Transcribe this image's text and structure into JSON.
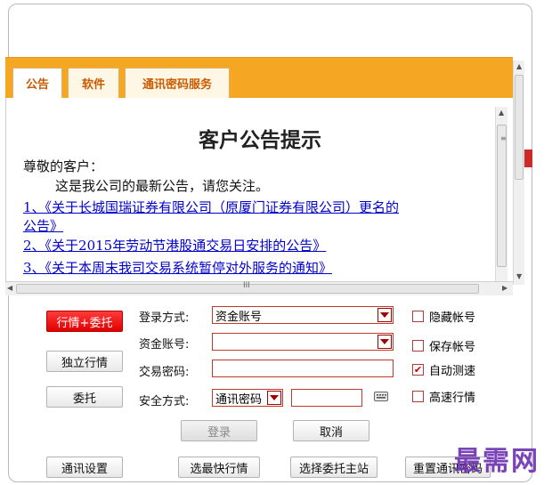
{
  "tabs": [
    {
      "label": "公告"
    },
    {
      "label": "软件"
    },
    {
      "label": "通讯密码服务"
    }
  ],
  "notice": {
    "title": "客户公告提示",
    "greeting": "尊敬的客户：",
    "intro": "这是我公司的最新公告，请您关注。",
    "links": [
      {
        "text": "1、《关于长城国瑞证券有限公司（原厦门证券有限公司）更名的"
      },
      {
        "text": "公告》"
      },
      {
        "text": "2、《关于2015年劳动节港股通交易日安排的公告》"
      },
      {
        "text": "3、《关于本周末我司交易系统暂停对外服务的通知》"
      }
    ]
  },
  "scroll": {
    "grip": "III"
  },
  "left_buttons": {
    "quote_trade": "行情+委托",
    "standalone_quote": "独立行情",
    "trade": "委托"
  },
  "form": {
    "login_method_label": "登录方式:",
    "login_method_value": "资金账号",
    "account_label": "资金账号:",
    "account_value": "",
    "password_label": "交易密码:",
    "password_value": "",
    "security_label": "安全方式:",
    "security_value": "通讯密码",
    "security_code": "",
    "login_button": "登录",
    "cancel_button": "取消"
  },
  "options": {
    "hide_account": {
      "label": "隐藏帐号",
      "checked": false
    },
    "save_account": {
      "label": "保存帐号",
      "checked": false
    },
    "auto_speed": {
      "label": "自动测速",
      "checked": true
    },
    "fast_quote": {
      "label": "高速行情",
      "checked": false
    }
  },
  "bottom_buttons": {
    "comm_settings": "通讯设置",
    "fastest_quote": "选最快行情",
    "select_host": "选择委托主站",
    "reset_comm": "重置通讯密码"
  },
  "watermark": "最需网",
  "colors": {
    "tab_bar": "#f5a623",
    "accent_red": "#e10000",
    "link": "#0000cc",
    "watermark": "#6c2fb0"
  },
  "icons": {
    "keyboard": "keyboard-icon",
    "check": "checkmark-icon"
  }
}
